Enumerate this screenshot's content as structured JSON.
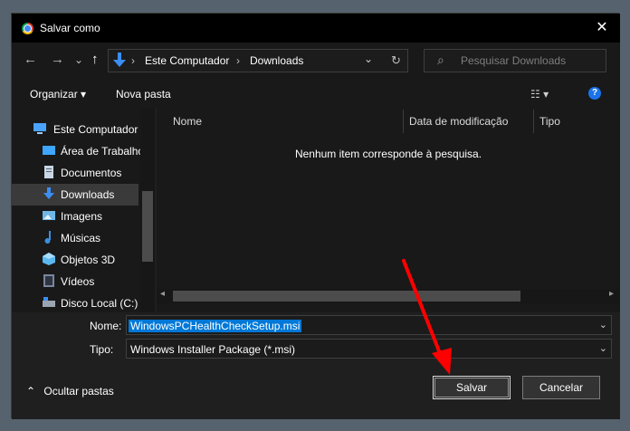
{
  "window": {
    "title": "Salvar como",
    "close_glyph": "✕"
  },
  "nav": {
    "back_glyph": "←",
    "forward_glyph": "→",
    "recent_glyph": "⌄",
    "up_glyph": "↑",
    "path": [
      "Este Computador",
      "Downloads"
    ],
    "path_sep": "›",
    "dropdown_glyph": "⌄",
    "refresh_glyph": "↻",
    "search_placeholder": "Pesquisar Downloads",
    "search_icon": "⌕"
  },
  "toolbar": {
    "organize_label": "Organizar ▾",
    "new_folder_label": "Nova pasta",
    "view_glyph": "☷ ▾",
    "help_glyph": "?"
  },
  "sidebar": {
    "items": [
      {
        "label": "Este Computador",
        "icon": "computer-icon",
        "color": "#4aa3ff"
      },
      {
        "label": "Área de Trabalho",
        "icon": "desktop-icon",
        "color": "#3ea6ff"
      },
      {
        "label": "Documentos",
        "icon": "documents-icon",
        "color": "#c9d6e3"
      },
      {
        "label": "Downloads",
        "icon": "download-icon",
        "color": "#3b8ef2"
      },
      {
        "label": "Imagens",
        "icon": "images-icon",
        "color": "#6fb7e8"
      },
      {
        "label": "Músicas",
        "icon": "music-icon",
        "color": "#3a8fe0"
      },
      {
        "label": "Objetos 3D",
        "icon": "objects3d-icon",
        "color": "#5bb8f0"
      },
      {
        "label": "Vídeos",
        "icon": "videos-icon",
        "color": "#7a86a0"
      },
      {
        "label": "Disco Local (C:)",
        "icon": "disk-icon",
        "color": "#9aa5b1"
      }
    ],
    "selected_index": 3
  },
  "files": {
    "columns": [
      "Nome",
      "Data de modificação",
      "Tipo"
    ],
    "empty_message": "Nenhum item corresponde à pesquisa."
  },
  "form": {
    "name_label": "Nome:",
    "name_value": "WindowsPCHealthCheckSetup.msi",
    "type_label": "Tipo:",
    "type_value": "Windows Installer Package (*.msi)",
    "dropdown_glyph": "⌄"
  },
  "footer": {
    "hide_folders_label": "Ocultar pastas",
    "hide_glyph": "⌃",
    "save_label": "Salvar",
    "cancel_label": "Cancelar"
  },
  "colors": {
    "accent": "#0078d7",
    "annotation_arrow": "#ff0000"
  }
}
